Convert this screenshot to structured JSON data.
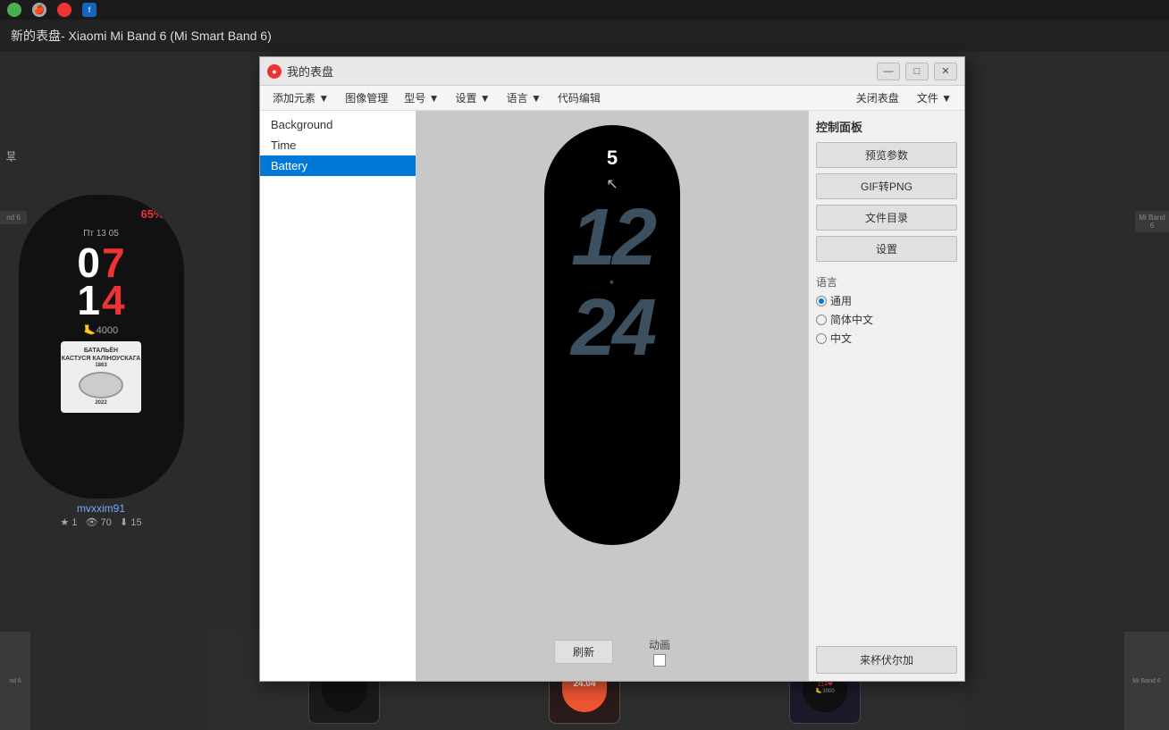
{
  "app": {
    "title": "新的表盘- Xiaomi Mi Band 6 (Mi Smart Band 6)",
    "topbar_icons": [
      "green-icon",
      "apple-icon",
      "red-icon",
      "facebook-icon"
    ]
  },
  "dialog": {
    "title": "我的表盘",
    "icon_text": "●",
    "minimize_label": "—",
    "maximize_label": "□",
    "close_label": "✕"
  },
  "menubar": {
    "items": [
      {
        "label": "添加元素 ▼",
        "key": "add-element"
      },
      {
        "label": "图像管理",
        "key": "image-manage"
      },
      {
        "label": "型号 ▼",
        "key": "model"
      },
      {
        "label": "设置 ▼",
        "key": "settings"
      },
      {
        "label": "语言 ▼",
        "key": "language"
      },
      {
        "label": "代码编辑",
        "key": "code-edit"
      }
    ],
    "right_items": [
      {
        "label": "关闭表盘",
        "key": "close-watchface"
      },
      {
        "label": "文件 ▼",
        "key": "file"
      }
    ]
  },
  "element_list": {
    "items": [
      {
        "label": "Background",
        "key": "background",
        "selected": false
      },
      {
        "label": "Time",
        "key": "time",
        "selected": false
      },
      {
        "label": "Battery",
        "key": "battery",
        "selected": true
      }
    ]
  },
  "preview": {
    "battery_number": "5",
    "time_top": "12",
    "time_bottom": "24",
    "refresh_btn": "刷新",
    "animation_label": "动画"
  },
  "control_panel": {
    "title": "控制面板",
    "buttons": [
      {
        "label": "预览参数",
        "key": "preview-params"
      },
      {
        "label": "GIF转PNG",
        "key": "gif-to-png"
      },
      {
        "label": "文件目录",
        "key": "file-dir"
      },
      {
        "label": "设置",
        "key": "settings-btn"
      }
    ],
    "language_section": {
      "title": "语言",
      "options": [
        {
          "label": "通用",
          "key": "general",
          "checked": true
        },
        {
          "label": "简体中文",
          "key": "simplified-chinese",
          "checked": false
        },
        {
          "label": "中文",
          "key": "chinese",
          "checked": false
        }
      ]
    },
    "bottom_btn": "来杯伏尔加"
  },
  "left_sidebar": {
    "label": "言",
    "watch_card": {
      "percentage": "65%",
      "date": "Пт  13  05",
      "hour1": "0",
      "hour2": "7",
      "min1": "1",
      "min2": "4",
      "steps": "🦶4000",
      "user": "mvxxim91",
      "stars": "1",
      "views": "70",
      "downloads": "15"
    }
  },
  "bottom_thumbs": [
    {
      "label": "nd  6",
      "color": "#2a2a2a"
    },
    {
      "label": "Mi Band 6",
      "color": "#333"
    },
    {
      "label": "Mi Band 6",
      "color": "#2a2a2a"
    }
  ]
}
